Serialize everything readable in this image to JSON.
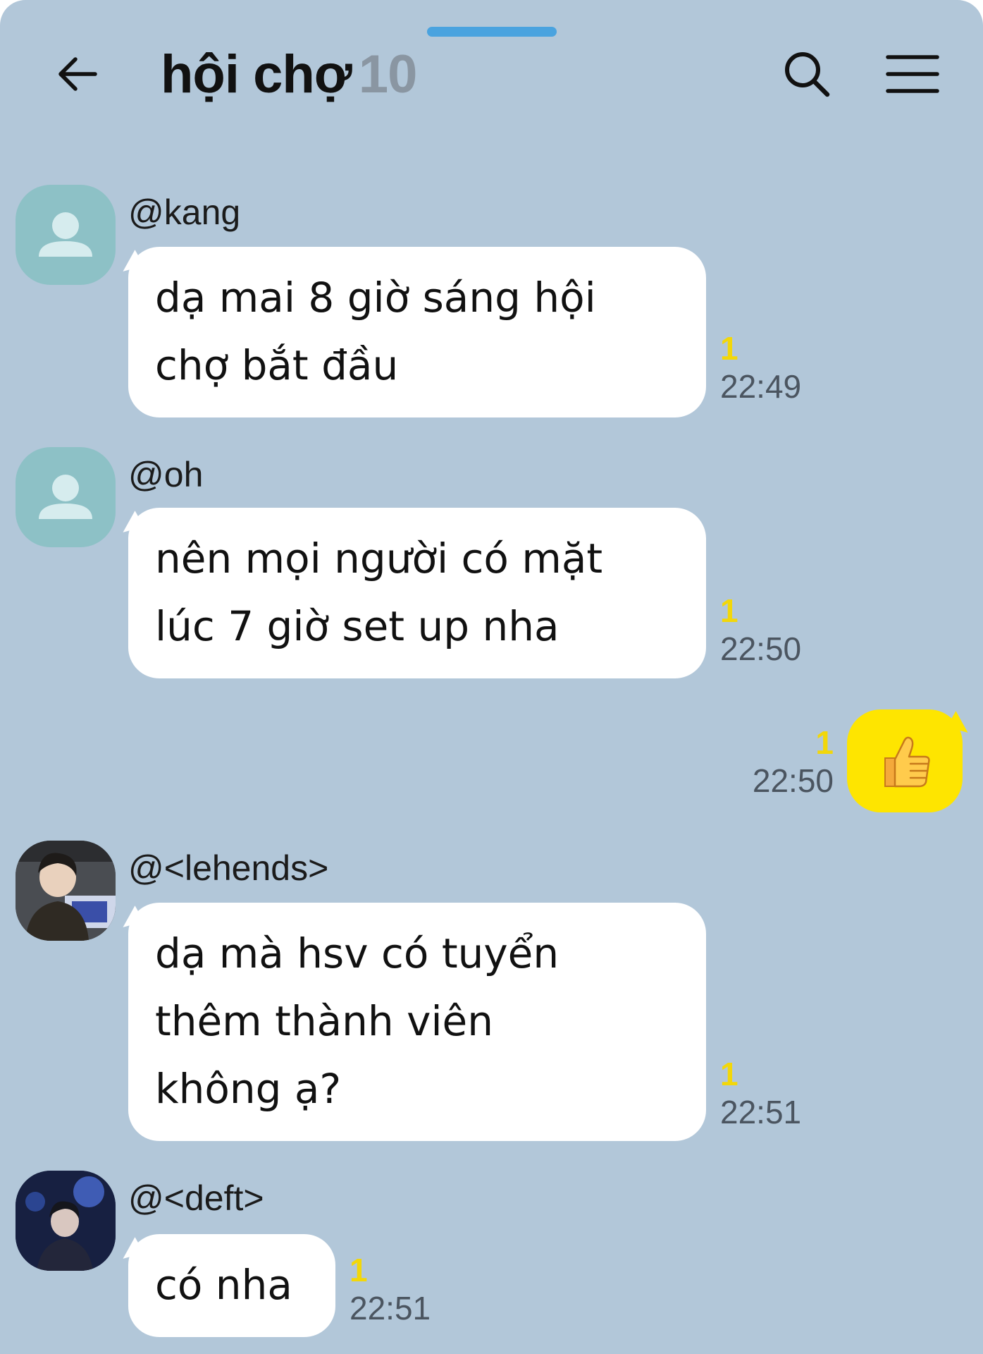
{
  "header": {
    "title": "hội chợ",
    "member_count": "10",
    "back_icon": "arrow-left-icon",
    "search_icon": "search-icon",
    "menu_icon": "hamburger-menu-icon"
  },
  "messages": [
    {
      "sender": "@kang",
      "lines": [
        "dạ mai 8 giờ sáng hội",
        "chợ bắt đầu"
      ],
      "unread": "1",
      "time": "22:49",
      "avatar": "default-person-icon"
    },
    {
      "sender": "@oh",
      "lines": [
        "nên mọi người có mặt",
        "lúc 7 giờ set up nha"
      ],
      "unread": "1",
      "time": "22:50",
      "avatar": "default-person-icon"
    },
    {
      "sender": "me",
      "emoji": "👍",
      "unread": "1",
      "time": "22:50"
    },
    {
      "sender": "@<lehends>",
      "lines": [
        "dạ mà hsv có tuyển",
        "thêm thành viên",
        "không ạ?"
      ],
      "unread": "1",
      "time": "22:51",
      "avatar": "photo-avatar"
    },
    {
      "sender": "@<deft>",
      "lines": [
        "có nha"
      ],
      "unread": "1",
      "time": "22:51",
      "avatar": "photo-avatar"
    }
  ],
  "colors": {
    "background": "#b2c7d9",
    "incoming_bubble": "#ffffff",
    "outgoing_bubble": "#fee500",
    "unread_count": "#f2d70a",
    "accent_bar": "#4aa3df"
  }
}
